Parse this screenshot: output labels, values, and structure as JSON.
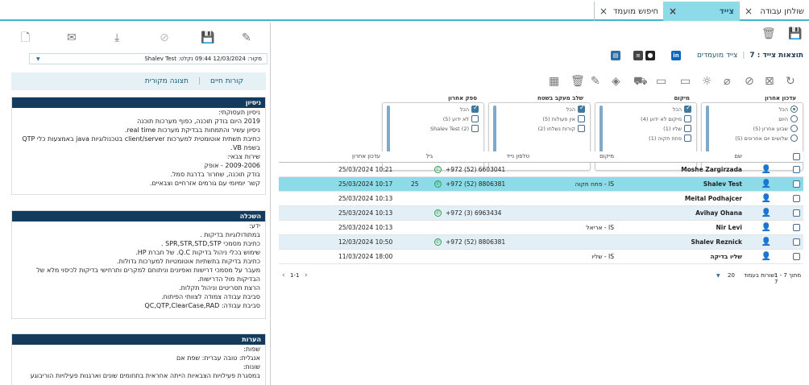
{
  "tabs": [
    {
      "label": "שולחן עבודה",
      "close": "×"
    },
    {
      "label": "צייד",
      "close": "×"
    },
    {
      "label": "חיפוש מועמד",
      "close": "×"
    }
  ],
  "left_panel": {
    "toolbar_icons": [
      "file-icon",
      "mail-icon",
      "download-icon",
      "block-icon",
      "save-icon",
      "pencil-icon"
    ],
    "source_select": "Shalev Test :מקור: 12/03/2024 09:44 נקלט",
    "views": {
      "cv": "קורות חיים",
      "original": "תצוגה מקורית"
    },
    "experience": {
      "title": "ניסיון",
      "lines": [
        "ניסיון תעסוקתי:",
        "2019 ‏‏היום בודק תוכנה, כפוף מערכות תוכנה",
        "ניסיון עשיר והתמחות בבדיקת מערכות real time.",
        "כתיבת תשתית אוטומטית למערכות client/server בטכנולוגיות java באמצעות כלי QTP",
        "בשפת VB.",
        "שירות צבאי:",
        "2009-2006 - אופק",
        "בודק תוכנה, שחרור בדרגת סמל.",
        "קשר יומיומי עם גורמים אזרחיים וצבאיים."
      ]
    },
    "education": {
      "title": "השכלה",
      "lines": [
        "ידע:",
        "במתודולוגיות בדיקות .",
        "כתיבת מסמכי SPR,STR,STD,STP .",
        "שימוש בכלי ניהול בדיקות Q.C. של חברת HP.",
        "כתיבת בדיקות בתשתיות אוטומטיות למערכות גדולות.",
        "מעבר על מסמכי דרישות ואפיונים וניתוחם למקרים ותרחישי בדיקות לכיסוי מלא של",
        "הבדיקות מול הדרישות.",
        "הרצת תסריטים וניהול תקלות.",
        "סביבת עבודה צמודה לצוותי הפיתוח.",
        "סביבת עבודה: QC,QTP,ClearCase,RAD"
      ]
    },
    "notes": {
      "title": "הערות",
      "lines": [
        "שפות:",
        "אנגלית: טובה עברית: שפת אם",
        "שונות:",
        "במסגרת פעילויות הצבאיות הייתה אחראית בתחומים שונים וארגנות פעילויות הוריבוגע"
      ]
    }
  },
  "right_panel": {
    "top_icons": [
      "trash-icon",
      "save-icon"
    ],
    "hunter_results": "תוצאות צייד : 7",
    "hunter_candidates": "צייד מועמדים",
    "social_icons": [
      "linkedin-icon",
      "github-icon",
      "stack-icon",
      "doc-icon"
    ],
    "action_icons": [
      "refresh-icon",
      "delete-doc-icon",
      "block-icon",
      "attach-icon",
      "bulb-icon",
      "sms-icon",
      "chat-icon",
      "cart-icon",
      "tag-icon",
      "pencil-icon",
      "trash-icon",
      "excel-icon"
    ],
    "filters": [
      {
        "title": "עדכון אחרון",
        "type": "radio",
        "items": [
          {
            "label": "הכל",
            "on": true
          },
          {
            "label": "היום",
            "on": false
          },
          {
            "label": "שבוע אחרון (5)",
            "on": false
          },
          {
            "label": "שלושים יום אחרונים (5)",
            "on": false
          }
        ]
      },
      {
        "title": "מיקום",
        "type": "check",
        "items": [
          {
            "label": "הכל",
            "on": true
          },
          {
            "label": "מיקום לא ידוע (4)",
            "on": false
          },
          {
            "label": "שליו (1)",
            "on": false
          },
          {
            "label": "פתח תקוה (1)",
            "on": false
          }
        ]
      },
      {
        "title": "שלב מעקב בשטח",
        "type": "check",
        "items": [
          {
            "label": "הכל",
            "on": true
          },
          {
            "label": "אין פעולות (5)",
            "on": false
          },
          {
            "label": "קורות נשלחו (2)",
            "on": false
          }
        ]
      },
      {
        "title": "ספק אחרון",
        "type": "check",
        "items": [
          {
            "label": "הכל",
            "on": true
          },
          {
            "label": "לא ידוע (5)",
            "on": false
          },
          {
            "label": "Shalev Test (2)",
            "on": false
          }
        ]
      }
    ],
    "table": {
      "headers": {
        "name": "שם",
        "location": "מיקום",
        "phone": "טלפון נייד",
        "age": "גיל",
        "updated": "עדכון אחרון"
      },
      "rows": [
        {
          "name": "Moshe Zargirzada",
          "location": "",
          "phone": "+972 (52) 6603041",
          "age": "",
          "updated": "25/03/2024 10:21",
          "wa": true,
          "style": ""
        },
        {
          "name": "Shalev Test",
          "location": "IS - פתח תקוה",
          "phone": "+972 (52) 8806381",
          "age": "25",
          "updated": "25/03/2024 10:17",
          "wa": true,
          "style": "sel2"
        },
        {
          "name": "Meital Podhajcer",
          "location": "",
          "phone": "",
          "age": "",
          "updated": "25/03/2024 10:13",
          "wa": false,
          "style": ""
        },
        {
          "name": "Avihay Ohana",
          "location": "",
          "phone": "+972 (3) 6963434",
          "age": "",
          "updated": "25/03/2024 10:13",
          "wa": true,
          "style": "alt"
        },
        {
          "name": "Nir Levi",
          "location": "IS - אריאל",
          "phone": "",
          "age": "",
          "updated": "25/03/2024 10:13",
          "wa": false,
          "style": ""
        },
        {
          "name": "Shalev Reznick",
          "location": "",
          "phone": "+972 (52) 8806381",
          "age": "",
          "updated": "12/03/2024 10:50",
          "wa": true,
          "style": "alt"
        },
        {
          "name": "שליו בדיקה",
          "location": "IS - שליו",
          "phone": "",
          "age": "",
          "updated": "11/03/2024 18:00",
          "wa": false,
          "style": ""
        }
      ]
    },
    "pagination": {
      "range": "1-1",
      "summary": "1 - 7 מתוך 7",
      "rows_per_page_label": "שורות בעמוד:",
      "rows_per_page": "20"
    }
  }
}
